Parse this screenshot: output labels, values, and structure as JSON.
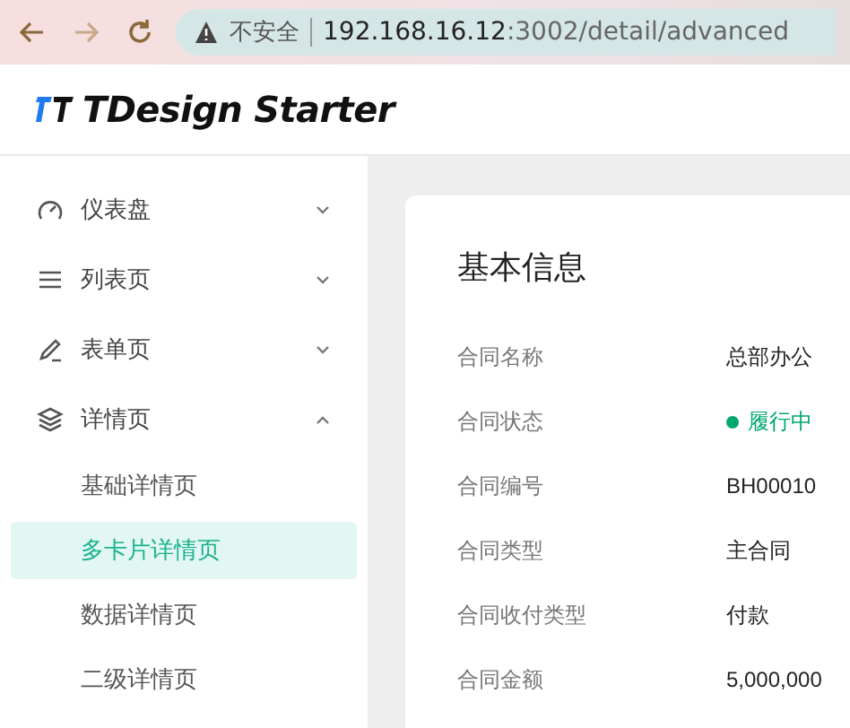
{
  "browser": {
    "security_label": "不安全",
    "url_host": "192.168.16.12",
    "url_path": ":3002/detail/advanced"
  },
  "header": {
    "logo_text": "TDesign Starter"
  },
  "sidebar": {
    "items": [
      {
        "label": "仪表盘",
        "kind": "dashboard",
        "expanded": false
      },
      {
        "label": "列表页",
        "kind": "list",
        "expanded": false
      },
      {
        "label": "表单页",
        "kind": "edit",
        "expanded": false
      },
      {
        "label": "详情页",
        "kind": "layers",
        "expanded": true,
        "children": [
          {
            "label": "基础详情页",
            "selected": false
          },
          {
            "label": "多卡片详情页",
            "selected": true
          },
          {
            "label": "数据详情页",
            "selected": false
          },
          {
            "label": "二级详情页",
            "selected": false
          }
        ]
      }
    ]
  },
  "card": {
    "title": "基本信息",
    "rows": [
      {
        "label": "合同名称",
        "value": "总部办公",
        "kind": "text"
      },
      {
        "label": "合同状态",
        "value": "履行中",
        "kind": "status",
        "color": "#00a870"
      },
      {
        "label": "合同编号",
        "value": "BH00010",
        "kind": "text"
      },
      {
        "label": "合同类型",
        "value": "主合同",
        "kind": "text"
      },
      {
        "label": "合同收付类型",
        "value": "付款",
        "kind": "text"
      },
      {
        "label": "合同金额",
        "value": "5,000,000",
        "kind": "text"
      }
    ]
  }
}
